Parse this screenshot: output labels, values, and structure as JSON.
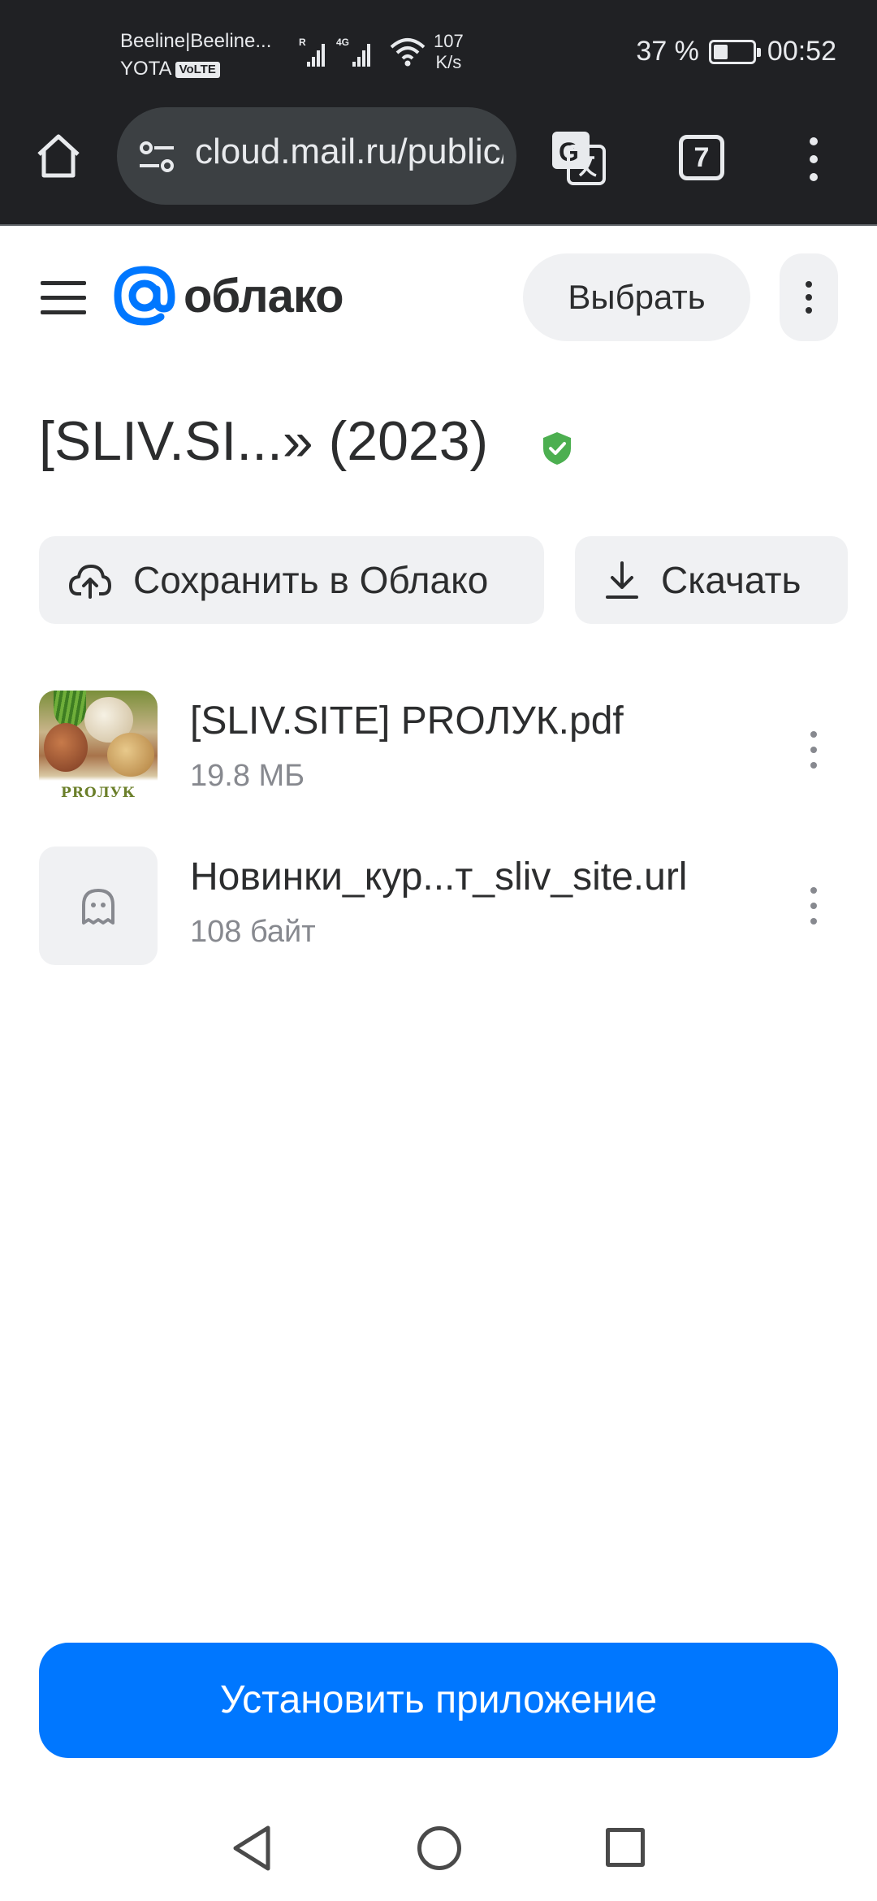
{
  "status_bar": {
    "carrier_line1": "Beeline|Beeline...",
    "carrier_line2": "YOTA",
    "volte_badge": "VoLTE",
    "signal1_tag": "R",
    "signal2_tag": "4G",
    "speed_value": "107",
    "speed_unit": "K/s",
    "battery_percent": "37 %",
    "battery_level": 0.37,
    "time": "00:52"
  },
  "browser": {
    "url": "cloud.mail.ru/public/",
    "tabs_count": "7"
  },
  "header": {
    "logo_text": "облако",
    "select_label": "Выбрать"
  },
  "folder": {
    "title": "[SLIV.SI...» (2023)",
    "save_label": "Сохранить в Облако",
    "download_label": "Скачать"
  },
  "files": [
    {
      "name": "[SLIV.SITE] PROЛУК.pdf",
      "size": "19.8 МБ",
      "thumb_label": "PROЛУК",
      "icon": "pdf-thumbnail"
    },
    {
      "name": "Новинки_кур...т_sliv_site.url",
      "size": "108 байт",
      "icon": "ghost-icon"
    }
  ],
  "install": {
    "label": "Установить приложение"
  },
  "colors": {
    "accent": "#0077ff",
    "verified": "#4caf50",
    "browser_chrome": "#202124"
  }
}
